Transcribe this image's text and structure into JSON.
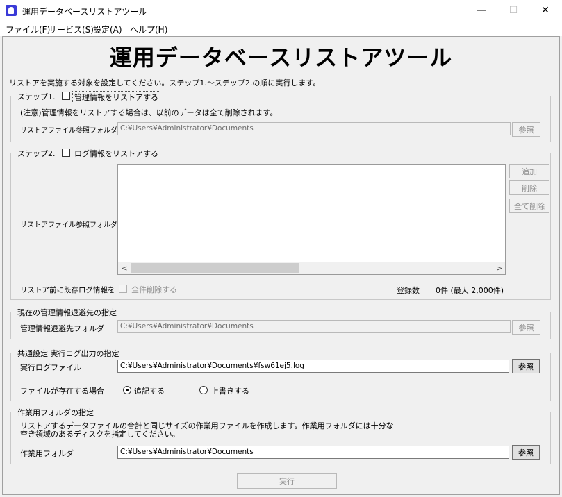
{
  "window": {
    "title": "運用データベースリストアツール",
    "minimize_glyph": "—",
    "maximize_glyph": "☐",
    "close_glyph": "✕"
  },
  "menu": {
    "file": "ファイル(F)",
    "service": "サービス(S)",
    "settings": "設定(A)",
    "help": "ヘルプ(H)"
  },
  "header": {
    "title": "運用データベースリストアツール",
    "instruction": "リストアを実施する対象を設定してください。ステップ1.～ステップ2.の順に実行します。"
  },
  "step1": {
    "legend": "ステップ1.",
    "checkbox_label": "管理情報をリストアする",
    "checked": false,
    "notice": "(注意)管理情報をリストアする場合は、以前のデータは全て削除されます。",
    "folder_label": "リストアファイル参照フォルダ",
    "folder_value": "C:¥Users¥Administrator¥Documents",
    "browse_label": "参照"
  },
  "step2": {
    "legend": "ステップ2.",
    "checkbox_label": "ログ情報をリストアする",
    "checked": false,
    "folder_label": "リストアファイル参照フォルダ",
    "add_label": "追加",
    "remove_label": "削除",
    "remove_all_label": "全て削除",
    "pre_label": "リストア前に既存ログ情報を",
    "delete_all_checkbox_label": "全件削除する",
    "count_label": "登録数",
    "count_value": "0件 (最大 2,000件)",
    "scroll_left": "<",
    "scroll_right": ">"
  },
  "backup": {
    "legend": "現在の管理情報退避先の指定",
    "folder_label": "管理情報退避先フォルダ",
    "folder_value": "C:¥Users¥Administrator¥Documents",
    "browse_label": "参照"
  },
  "common": {
    "legend": "共通設定 実行ログ出力の指定",
    "log_label": "実行ログファイル",
    "log_value": "C:¥Users¥Administrator¥Documents¥fsw61ej5.log",
    "browse_label": "参照",
    "exists_label": "ファイルが存在する場合",
    "append_label": "追記する",
    "overwrite_label": "上書きする",
    "selected": "append"
  },
  "work": {
    "legend": "作業用フォルダの指定",
    "description_line1": "リストアするデータファイルの合計と同じサイズの作業用ファイルを作成します。作業用フォルダには十分な",
    "description_line2": "空き領域のあるディスクを指定してください。",
    "folder_label": "作業用フォルダ",
    "folder_value": "C:¥Users¥Administrator¥Documents",
    "browse_label": "参照"
  },
  "execute_label": "実行"
}
